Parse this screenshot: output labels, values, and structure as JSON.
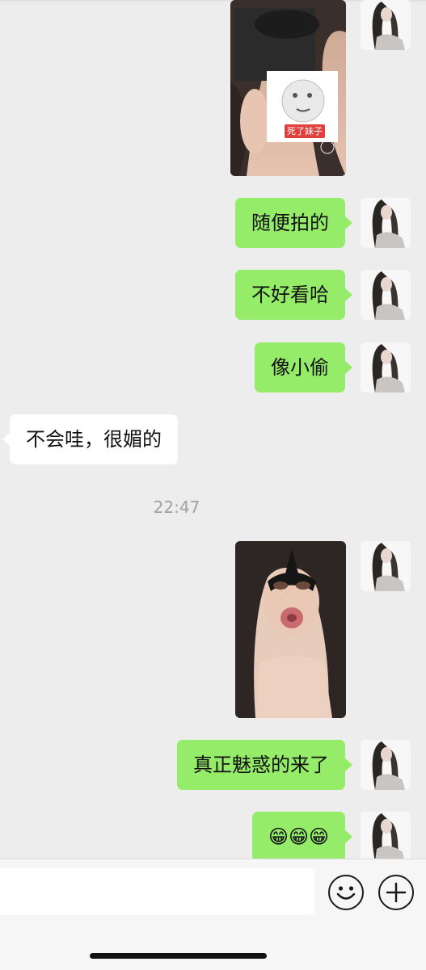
{
  "messages": [
    {
      "type": "image",
      "from": "me",
      "sticker_text": "死了妹子"
    },
    {
      "type": "text",
      "from": "me",
      "text": "随便拍的"
    },
    {
      "type": "text",
      "from": "me",
      "text": "不好看哈"
    },
    {
      "type": "text",
      "from": "me",
      "text": "像小偷"
    },
    {
      "type": "text",
      "from": "them",
      "text": "不会哇，很媚的"
    },
    {
      "type": "timestamp",
      "text": "22:47"
    },
    {
      "type": "image",
      "from": "me"
    },
    {
      "type": "text",
      "from": "me",
      "text": "真正魅惑的来了"
    },
    {
      "type": "text",
      "from": "me",
      "text": "😁😁😁"
    }
  ],
  "input": {
    "placeholder": "",
    "emoji_icon": "emoji-face-icon",
    "plus_icon": "plus-circle-icon"
  },
  "colors": {
    "background": "#ededed",
    "outgoing_bubble": "#95ec69",
    "incoming_bubble": "#ffffff",
    "timestamp": "#a0a0a0"
  }
}
